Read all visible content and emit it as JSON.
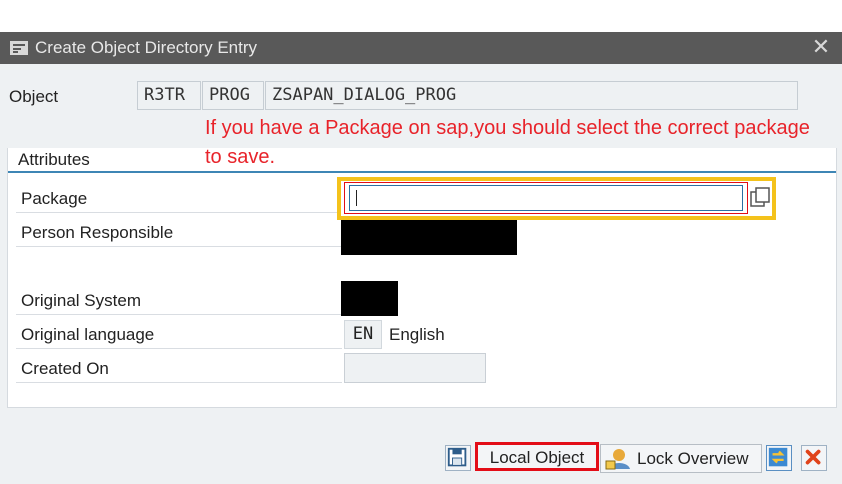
{
  "dialog": {
    "title": "Create Object Directory Entry",
    "close_symbol": "✕"
  },
  "object": {
    "label": "Object",
    "pgmid": "R3TR",
    "type": "PROG",
    "name": "ZSAPAN_DIALOG_PROG"
  },
  "annotation": {
    "text": "If you have a Package on sap,you should select the correct package to save.",
    "color": "#e8232a"
  },
  "attributes": {
    "heading": "Attributes",
    "package_label": "Package",
    "package_value": "",
    "person_label": "Person Responsible",
    "system_label": "Original System",
    "language_label": "Original language",
    "language_code": "EN",
    "language_name": "English",
    "created_label": "Created On",
    "created_value": ""
  },
  "footer": {
    "save_icon": "save-icon",
    "local_object_label": "Local Object",
    "lock_overview_label": "Lock Overview",
    "cancel_icon": "cancel-icon"
  },
  "colors": {
    "titlebar": "#595959",
    "highlight_yellow": "#f4c21b",
    "highlight_red": "#e30d17",
    "group_rule": "#3e86b5"
  }
}
